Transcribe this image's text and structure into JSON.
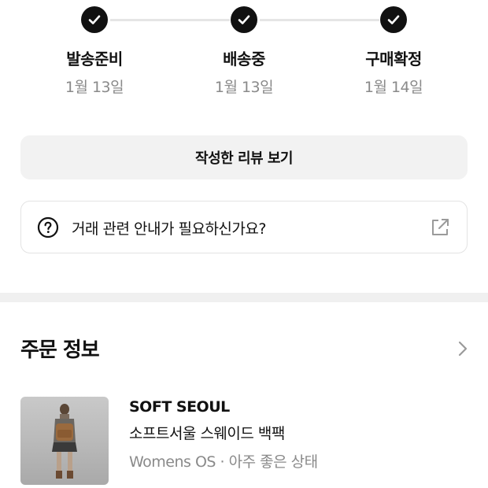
{
  "tracker": {
    "steps": [
      {
        "label": "발송준비",
        "date": "1월 13일",
        "icon": "check-icon"
      },
      {
        "label": "배송중",
        "date": "1월 13일",
        "icon": "check-icon"
      },
      {
        "label": "구매확정",
        "date": "1월 14일",
        "icon": "check-icon"
      }
    ]
  },
  "review_button": {
    "label": "작성한 리뷰 보기"
  },
  "help_card": {
    "label": "거래 관련 안내가 필요하신가요?",
    "leading_icon": "question-circle-icon",
    "trailing_icon": "external-link-icon"
  },
  "order_info": {
    "title": "주문 정보",
    "chevron_icon": "chevron-right-icon",
    "product": {
      "brand": "SOFT SEOUL",
      "name": "소프트서울 스웨이드 백팩",
      "meta": "Womens OS · 아주 좋은 상태",
      "thumbnail": "product-photo"
    }
  },
  "colors": {
    "accent": "#111111",
    "muted_text": "#8a8a8a",
    "button_bg": "#f2f2f2",
    "divider": "#f0f0f0"
  }
}
